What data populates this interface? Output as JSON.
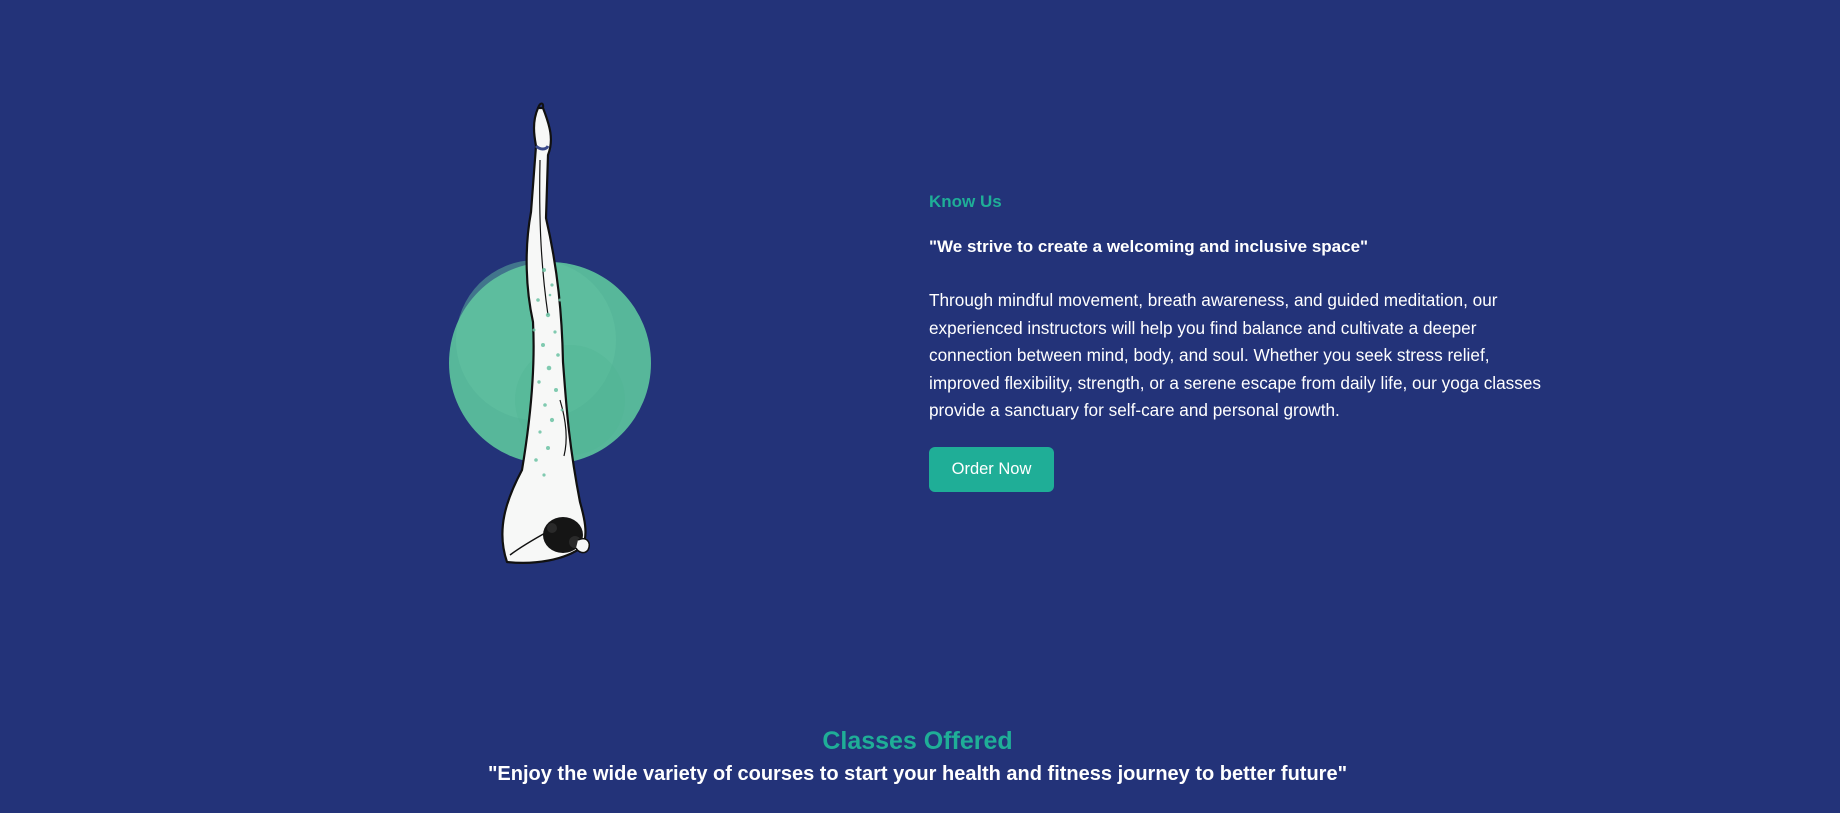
{
  "about": {
    "illustration_icon": "yoga-shoulder-stand-illustration",
    "eyebrow": "Know Us",
    "quote": "\"We strive to create a welcoming and inclusive space\"",
    "body": "Through mindful movement, breath awareness, and guided meditation, our experienced instructors will help you find balance and cultivate a deeper connection between mind, body, and soul. Whether you seek stress relief, improved flexibility, strength, or a serene escape from daily life, our yoga classes provide a sanctuary for self-care and personal growth.",
    "button_label": "Order Now"
  },
  "classes": {
    "title": "Classes Offered",
    "subtitle": "\"Enjoy the wide variety of courses to start your health and fitness journey to better future\""
  },
  "colors": {
    "background": "#233379",
    "accent": "#1fae97",
    "circle": "#5bbf9c",
    "text": "#ffffff"
  }
}
